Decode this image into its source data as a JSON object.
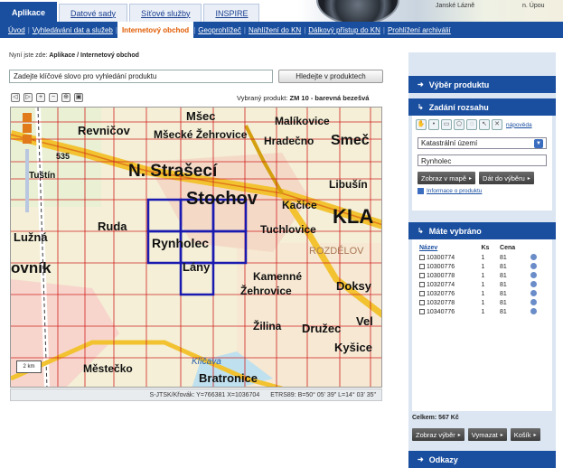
{
  "top_tabs": [
    "Aplikace",
    "Datové sady",
    "Síťové služby",
    "INSPIRE"
  ],
  "header_map_text": {
    "a": "Janské Lázně",
    "b": "n. Úpou"
  },
  "nav": [
    "Úvod",
    "Vyhledávání dat a služeb",
    "Internetový obchod",
    "Geoprohlížeč",
    "Nahlížení do KN",
    "Dálkový přístup do KN",
    "Prohlížení archiválií"
  ],
  "breadcrumb": {
    "prefix": "Nyní jste zde:",
    "path": "Aplikace / Internetový obchod"
  },
  "search": {
    "value": "Zadejte klíčové slovo pro vyhledání produktu",
    "button": "Hledejte v produktech"
  },
  "map": {
    "selected_product_label": "Vybraný produkt:",
    "selected_product": "ZM 10 - barevná bezešvá",
    "places": [
      "Mšec",
      "Malíkovice",
      "Revničov",
      "Mšecké Žehrovice",
      "Hradečno",
      "Smeč",
      "535",
      "N. Strašecí",
      "Tuštín",
      "Stochov",
      "Libušín",
      "Kačice",
      "KLA",
      "Ruda",
      "Tuchlovice",
      "ROZDĚLOV",
      "Lužná",
      "Rynholec",
      "Lány",
      "Kamenné",
      "Žehrovice",
      "Doksy",
      "ovník",
      "Žilina",
      "Družec",
      "Vel",
      "Kyšice",
      "Klíčava",
      "Městečko",
      "Bratronice"
    ],
    "scale": "2 km",
    "status_coords": "S-JTSK/Křovák: Y=766381 X=1036704",
    "status_etrs": "ETRS89: B=50° 05' 39\" L=14° 03' 35\""
  },
  "panel": {
    "vyber_produktu": "Výběr produktu",
    "zadani_rozsahu": "Zadání rozsahu",
    "napoveda": "nápověda",
    "territory_select": "Katastrální území",
    "territory_input": "Rynholec",
    "btn_zobraz": "Zobraz v mapě",
    "btn_dat": "Dát do výběru",
    "info_link": "Informace o produktu",
    "mate_vybrano": "Máte vybráno",
    "table": {
      "headers": [
        "Název",
        "Ks",
        "Cena"
      ],
      "rows": [
        [
          "10300774",
          "1",
          "81"
        ],
        [
          "10300776",
          "1",
          "81"
        ],
        [
          "10300778",
          "1",
          "81"
        ],
        [
          "10320774",
          "1",
          "81"
        ],
        [
          "10320776",
          "1",
          "81"
        ],
        [
          "10320778",
          "1",
          "81"
        ],
        [
          "10340776",
          "1",
          "81"
        ]
      ]
    },
    "total": "Celkem: 567 Kč",
    "btn_zobraz_vyber": "Zobraz výběr",
    "btn_vymazat": "Vymazat",
    "btn_kosik": "Košík",
    "odkazy": "Odkazy"
  },
  "colors": {
    "nav_blue": "#1a4fa0",
    "active_orange": "#e05a00",
    "grid_red": "#d02020",
    "selection_blue": "#1a1ab0",
    "road_yellow": "#f2c230"
  }
}
